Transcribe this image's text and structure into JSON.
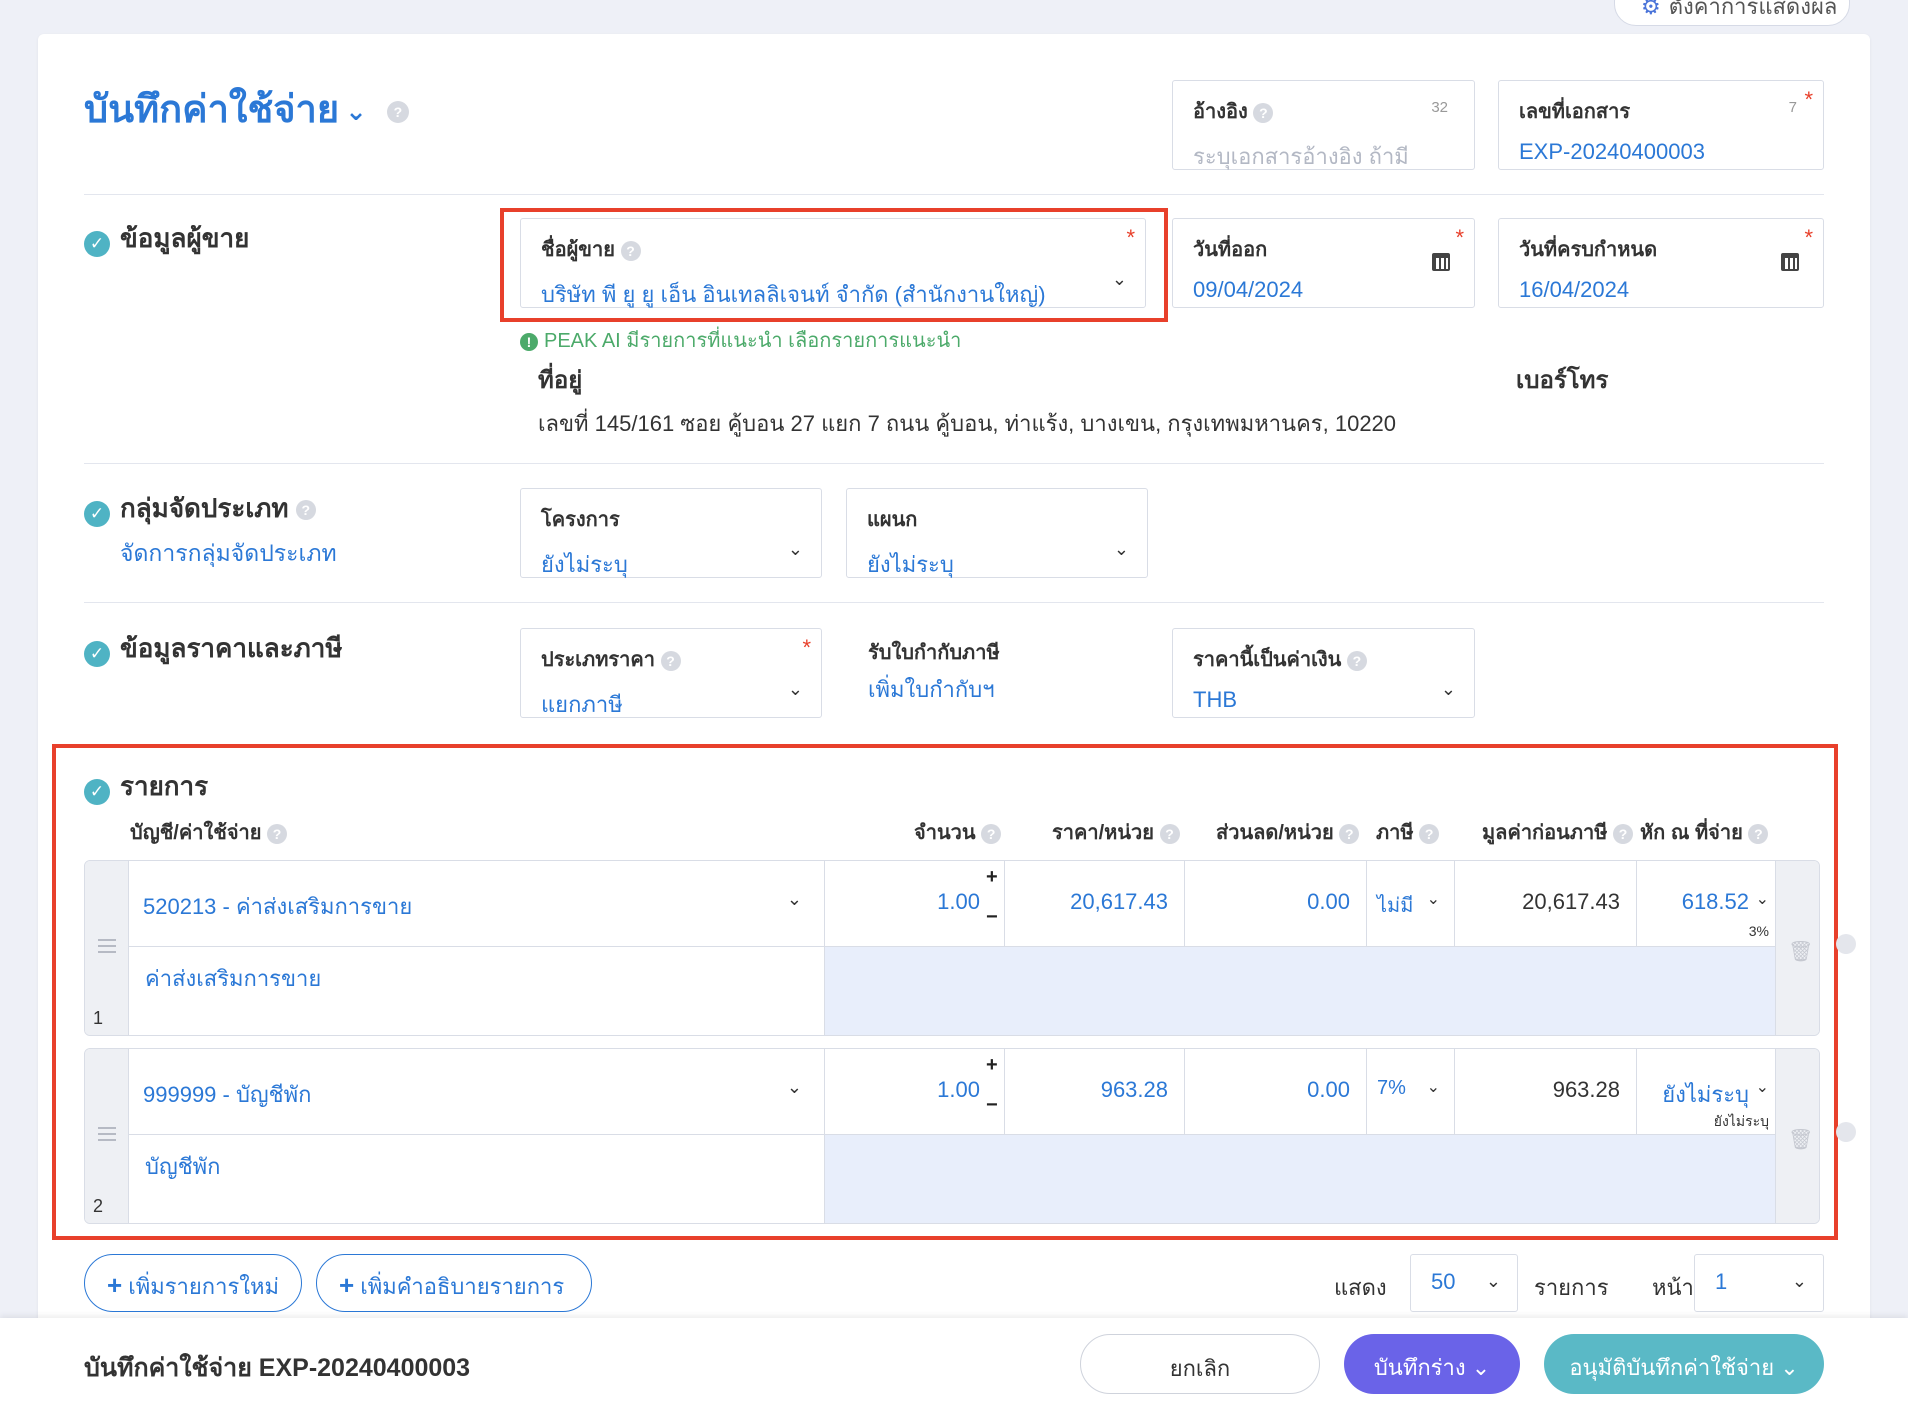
{
  "top_button": {
    "label": "ตั้งค่าการแสดงผล"
  },
  "header": {
    "title": "บันทึกค่าใช้จ่าย"
  },
  "reference": {
    "label": "อ้างอิง",
    "placeholder": "ระบุเอกสารอ้างอิง ถ้ามี",
    "counter": "32"
  },
  "doc_number": {
    "label": "เลขที่เอกสาร",
    "value": "EXP-20240400003",
    "counter": "7"
  },
  "vendor_section": {
    "heading": "ข้อมูลผู้ขาย",
    "vendor_label": "ชื่อผู้ขาย",
    "vendor_value": "บริษัท พี ยู ยู เอ็น อินเทลลิเจนท์ จำกัด (สำนักงานใหญ่)",
    "issue_date_label": "วันที่ออก",
    "issue_date": "09/04/2024",
    "due_date_label": "วันที่ครบกำหนด",
    "due_date": "16/04/2024",
    "ai_notice": "PEAK AI มีรายการที่แนะนำ เลือกรายการแนะนำ",
    "address_label": "ที่อยู่",
    "address": "เลขที่ 145/161 ซอย คู้บอน 27 แยก 7 ถนน คู้บอน, ท่าแร้ง, บางเขน, กรุงเทพมหานคร, 10220",
    "phone_label": "เบอร์โทร"
  },
  "classification": {
    "heading": "กลุ่มจัดประเภท",
    "manage_link": "จัดการกลุ่มจัดประเภท",
    "project_label": "โครงการ",
    "project_value": "ยังไม่ระบุ",
    "dept_label": "แผนก",
    "dept_value": "ยังไม่ระบุ"
  },
  "pricing": {
    "heading": "ข้อมูลราคาและภาษี",
    "price_type_label": "ประเภทราคา",
    "price_type_value": "แยกภาษี",
    "tax_invoice_label": "รับใบกำกับภาษี",
    "tax_invoice_link": "เพิ่มใบกำกับฯ",
    "currency_label": "ราคานี้เป็นค่าเงิน",
    "currency_value": "THB"
  },
  "items": {
    "heading": "รายการ",
    "columns": {
      "account": "บัญชี/ค่าใช้จ่าย",
      "qty": "จำนวน",
      "price": "ราคา/หน่วย",
      "discount": "ส่วนลด/หน่วย",
      "tax": "ภาษี",
      "pretax": "มูลค่าก่อนภาษี",
      "wht": "หัก ณ ที่จ่าย"
    },
    "rows": [
      {
        "no": "1",
        "account": "520213 - ค่าส่งเสริมการขาย",
        "qty": "1.00",
        "price": "20,617.43",
        "discount": "0.00",
        "tax": "ไม่มี",
        "pretax": "20,617.43",
        "wht": "618.52",
        "wht_rate": "3%",
        "description": "ค่าส่งเสริมการขาย"
      },
      {
        "no": "2",
        "account": "999999 - บัญชีพัก",
        "qty": "1.00",
        "price": "963.28",
        "discount": "0.00",
        "tax": "7%",
        "pretax": "963.28",
        "wht": "ยังไม่ระบุ",
        "wht_rate": "ยังไม่ระบุ",
        "description": "บัญชีพัก"
      }
    ]
  },
  "actions": {
    "add_item": "เพิ่มรายการใหม่",
    "add_desc": "เพิ่มคำอธิบายรายการ",
    "show_label": "แสดง",
    "page_size": "50",
    "items_label": "รายการ",
    "page_label": "หน้า",
    "page": "1"
  },
  "footer": {
    "title": "บันทึกค่าใช้จ่าย EXP-20240400003",
    "cancel": "ยกเลิก",
    "save_draft": "บันทึกร่าง",
    "approve": "อนุมัติบันทึกค่าใช้จ่าย"
  },
  "colors": {
    "accent": "#2b78d6",
    "required": "#e8402b",
    "draft_button": "#6a63e8",
    "approve_button": "#5ab9c6",
    "check": "#4fb3c4",
    "highlight": "#e8402b"
  }
}
